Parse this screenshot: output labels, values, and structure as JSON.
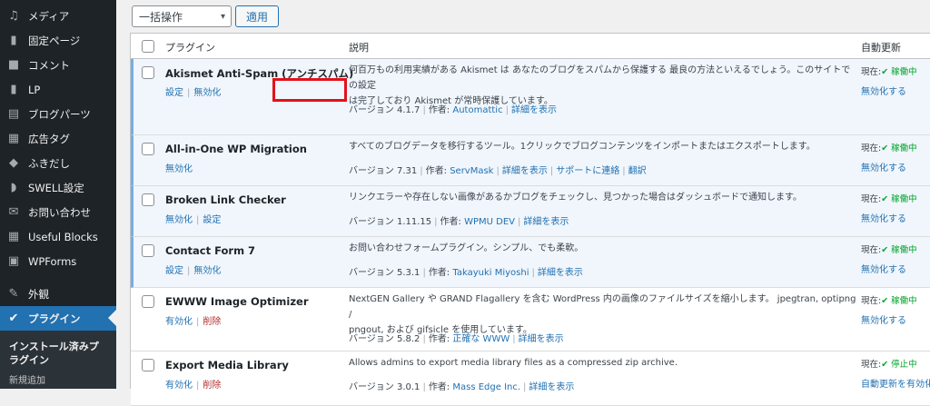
{
  "sidebar": {
    "items": [
      {
        "label": "メディア",
        "icon": "media-icon"
      },
      {
        "label": "固定ページ",
        "icon": "page-icon"
      },
      {
        "label": "コメント",
        "icon": "comment-icon"
      },
      {
        "label": "LP",
        "icon": "document-icon"
      },
      {
        "label": "ブログパーツ",
        "icon": "blog-parts-icon"
      },
      {
        "label": "広告タグ",
        "icon": "ad-tag-icon"
      },
      {
        "label": "ふきだし",
        "icon": "balloon-icon"
      },
      {
        "label": "SWELL設定",
        "icon": "swell-icon"
      },
      {
        "label": "お問い合わせ",
        "icon": "mail-icon"
      },
      {
        "label": "Useful Blocks",
        "icon": "grid-icon"
      },
      {
        "label": "WPForms",
        "icon": "form-icon"
      },
      {
        "label": "外観",
        "icon": "appearance-icon"
      },
      {
        "label": "プラグイン",
        "icon": "plugin-icon"
      }
    ],
    "submenu": {
      "installed": "インストール済みプラグイン",
      "add_new": "新規追加"
    }
  },
  "toolbar": {
    "bulk_action": "一括操作",
    "apply": "適用"
  },
  "table": {
    "headers": {
      "plugin": "プラグイン",
      "description": "説明",
      "auto_update": "自動更新"
    },
    "rows": [
      {
        "name": "Akismet Anti-Spam (アンチスパム)",
        "actions": [
          "設定",
          "無効化"
        ],
        "desc_lines": [
          "何百万もの利用実績がある Akismet は あなたのブログをスパムから保護する 最良の方法といえるでしょう。このサイトでの設定",
          "は完了しており Akismet が常時保護しています。"
        ],
        "version": "バージョン 4.1.7",
        "author_label": "作者:",
        "author": "Automattic",
        "details": "詳細を表示",
        "extra": [],
        "auto_status_prefix": "現在:",
        "auto_status": "✔ 稼働中",
        "auto_link": "無効化する"
      },
      {
        "name": "All-in-One WP Migration",
        "actions": [
          "無効化"
        ],
        "desc_lines": [
          "すべてのブログデータを移行するツール。1クリックでブログコンテンツをインポートまたはエクスポートします。"
        ],
        "version": "バージョン 7.31",
        "author_label": "作者:",
        "author": "ServMask",
        "details": "詳細を表示",
        "extra": [
          "サポートに連絡",
          "翻訳"
        ],
        "auto_status_prefix": "現在:",
        "auto_status": "✔ 稼働中",
        "auto_link": "無効化する"
      },
      {
        "name": "Broken Link Checker",
        "actions": [
          "無効化",
          "設定"
        ],
        "desc_lines": [
          "リンクエラーや存在しない画像があるかブログをチェックし、見つかった場合はダッシュボードで通知します。"
        ],
        "version": "バージョン 1.11.15",
        "author_label": "作者:",
        "author": "WPMU DEV",
        "details": "詳細を表示",
        "extra": [],
        "auto_status_prefix": "現在:",
        "auto_status": "✔ 稼働中",
        "auto_link": "無効化する"
      },
      {
        "name": "Contact Form 7",
        "actions": [
          "設定",
          "無効化"
        ],
        "desc_lines": [
          "お問い合わせフォームプラグイン。シンプル、でも柔軟。"
        ],
        "version": "バージョン 5.3.1",
        "author_label": "作者:",
        "author": "Takayuki Miyoshi",
        "details": "詳細を表示",
        "extra": [],
        "auto_status_prefix": "現在:",
        "auto_status": "✔ 稼働中",
        "auto_link": "無効化する"
      },
      {
        "name": "EWWW Image Optimizer",
        "actions": [
          "有効化",
          "削除"
        ],
        "desc_lines": [
          "NextGEN Gallery や GRAND Flagallery を含む WordPress 内の画像のファイルサイズを縮小します。 jpegtran, optipng /",
          "pngout, および gifsicle を使用しています。"
        ],
        "version": "バージョン 5.8.2",
        "author_label": "作者:",
        "author": "正確な WWW",
        "details": "詳細を表示",
        "extra": [],
        "auto_status_prefix": "現在:",
        "auto_status": "✔ 稼働中",
        "auto_link": "無効化する"
      },
      {
        "name": "Export Media Library",
        "actions": [
          "有効化",
          "削除"
        ],
        "desc_lines": [
          "Allows admins to export media library files as a compressed zip archive."
        ],
        "version": "バージョン 3.0.1",
        "author_label": "作者:",
        "author": "Mass Edge Inc.",
        "details": "詳細を表示",
        "extra": [],
        "auto_status_prefix": "現在:",
        "auto_status": "✔ 停止中",
        "auto_link": "自動更新を有効化"
      }
    ]
  },
  "colors": {
    "sidebar_bg": "#1d2327",
    "active_menu": "#2271b1",
    "link": "#2271b1",
    "delete": "#b32d2e",
    "status_on": "#00a32a",
    "highlight_box": "#e3111b"
  }
}
